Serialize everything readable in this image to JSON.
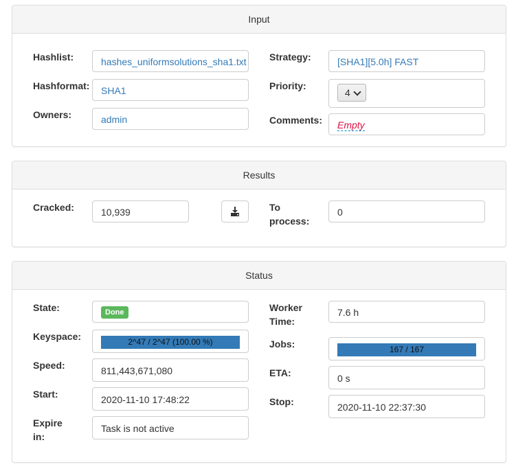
{
  "input": {
    "title": "Input",
    "hashlist_label": "Hashlist:",
    "hashlist_value": "hashes_uniformsolutions_sha1.txt",
    "hashformat_label": "Hashformat:",
    "hashformat_value": "SHA1",
    "owners_label": "Owners:",
    "owners_value": "admin",
    "strategy_label": "Strategy:",
    "strategy_value": "[SHA1][5.0h] FAST",
    "priority_label": "Priority:",
    "priority_value": "4",
    "comments_label": "Comments:",
    "comments_value": "Empty"
  },
  "results": {
    "title": "Results",
    "cracked_label": "Cracked:",
    "cracked_value": "10,939",
    "download_icon": "download-icon",
    "to_process_label_line1": "To",
    "to_process_label_line2": "process:",
    "to_process_value": "0"
  },
  "status": {
    "title": "Status",
    "state_label": "State:",
    "state_value": "Done",
    "keyspace_label": "Keyspace:",
    "keyspace_text": "2^47 / 2^47 (100.00 %)",
    "keyspace_progress": 1.0,
    "speed_label": "Speed:",
    "speed_value": "811,443,671,080",
    "start_label": "Start:",
    "start_value": "2020-11-10 17:48:22",
    "expire_label_line1": "Expire",
    "expire_label_line2": "in:",
    "expire_value": "Task is not active",
    "worker_time_label_line1": "Worker",
    "worker_time_label_line2": "Time:",
    "worker_time_value": "7.6 h",
    "jobs_label": "Jobs:",
    "jobs_text": "167 / 167",
    "jobs_progress": 1.0,
    "eta_label": "ETA:",
    "eta_value": "0 s",
    "stop_label": "Stop:",
    "stop_value": "2020-11-10 22:37:30"
  },
  "colors": {
    "link": "#337ab7",
    "done_badge": "#5cb85c",
    "progress": "#337ab7",
    "empty_text": "#dd1144"
  }
}
